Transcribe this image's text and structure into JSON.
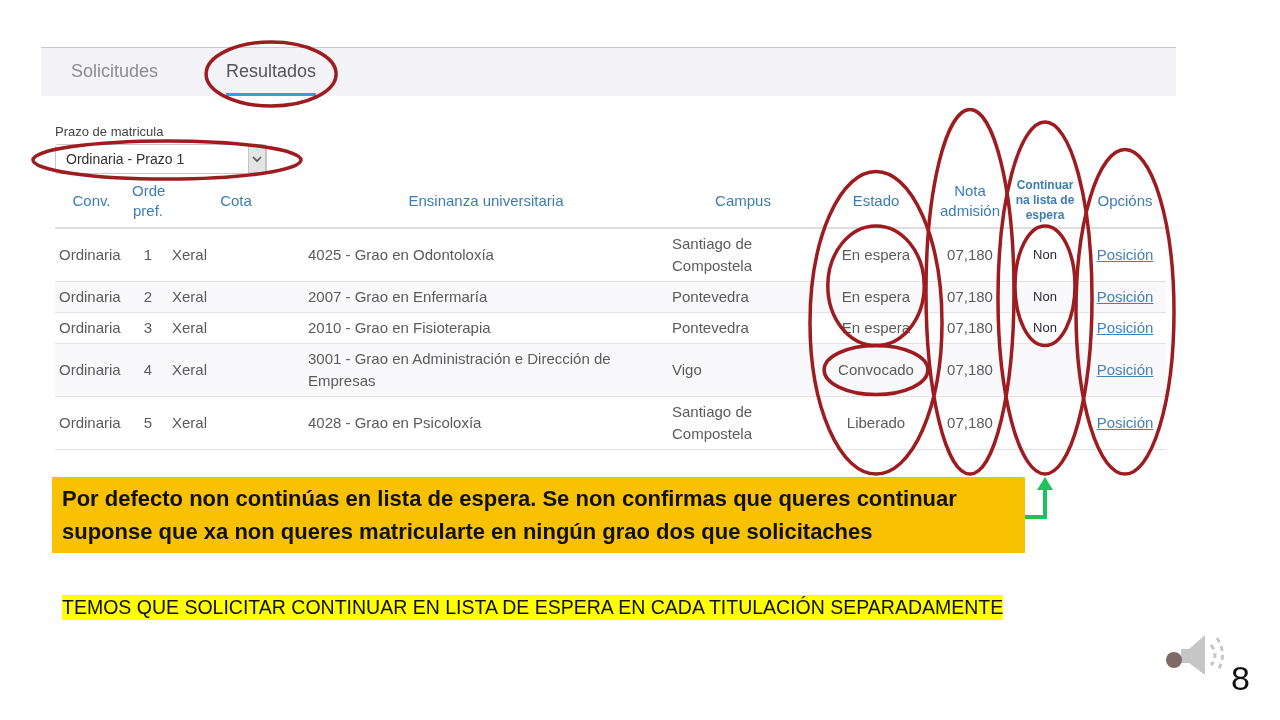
{
  "tabs": [
    {
      "label": "Solicitudes",
      "selected": false,
      "circled": false
    },
    {
      "label": "Resultados",
      "selected": true,
      "circled": true
    }
  ],
  "filter": {
    "label": "Prazo de matricula",
    "value": "Ordinaria - Prazo 1",
    "circled": true
  },
  "table": {
    "columns": [
      {
        "label": "Conv.",
        "circled": false,
        "arrow": false
      },
      {
        "label": "Orde pref.",
        "circled": false,
        "arrow": false
      },
      {
        "label": "Cota",
        "circled": false,
        "arrow": false
      },
      {
        "label": "Ensinanza universitaria",
        "circled": false,
        "arrow": false
      },
      {
        "label": "Campus",
        "circled": false,
        "arrow": false
      },
      {
        "label": "Estado",
        "circled": true,
        "arrow": false
      },
      {
        "label": "Nota admisión",
        "circled": true,
        "arrow": false
      },
      {
        "label": "Continuar na lista de espera",
        "circled": true,
        "arrow": true
      },
      {
        "label": "Opcións",
        "circled": true,
        "arrow": false
      }
    ],
    "rows": [
      {
        "conv": "Ordinaria",
        "orde": "1",
        "cota": "Xeral",
        "ensinanza": "4025 - Grao en Odontoloxía",
        "campus": "Santiago de Compostela",
        "estado": "En espera",
        "nota": "07,180",
        "continuar": "Non",
        "opcions": "Posición",
        "estado_circled": false,
        "estado_group_circled": true,
        "continuar_group_circled": true
      },
      {
        "conv": "Ordinaria",
        "orde": "2",
        "cota": "Xeral",
        "ensinanza": "2007 - Grao en Enfermaría",
        "campus": "Pontevedra",
        "estado": "En espera",
        "nota": "07,180",
        "continuar": "Non",
        "opcions": "Posición",
        "estado_circled": false,
        "estado_group_circled": true,
        "continuar_group_circled": true
      },
      {
        "conv": "Ordinaria",
        "orde": "3",
        "cota": "Xeral",
        "ensinanza": "2010 - Grao en Fisioterapia",
        "campus": "Pontevedra",
        "estado": "En espera",
        "nota": "07,180",
        "continuar": "Non",
        "opcions": "Posición",
        "estado_circled": false,
        "estado_group_circled": true,
        "continuar_group_circled": true
      },
      {
        "conv": "Ordinaria",
        "orde": "4",
        "cota": "Xeral",
        "ensinanza": "3001 - Grao en Administración e Dirección de Empresas",
        "campus": "Vigo",
        "estado": "Convocado",
        "nota": "07,180",
        "opcions": "Posición",
        "estado_circled": true,
        "estado_group_circled": false,
        "continuar_group_circled": false
      },
      {
        "conv": "Ordinaria",
        "orde": "5",
        "cota": "Xeral",
        "ensinanza": "4028 - Grao en Psicoloxía",
        "campus": "Santiago de Compostela",
        "estado": "Liberado",
        "nota": "07,180",
        "opcions": "Posición",
        "estado_circled": false,
        "estado_group_circled": false,
        "continuar_group_circled": false
      }
    ]
  },
  "callout": {
    "text": "Por defecto non continúas en lista de espera. Se non confirmas que queres continuar suponse que xa non queres matricularte en ningún grao dos que solicitaches"
  },
  "note": {
    "text": "TEMOS QUE SOLICITAR CONTINUAR EN LISTA DE ESPERA EN CADA TITULACIÓN SEPARADAMENTE"
  },
  "slide_number": "8"
}
